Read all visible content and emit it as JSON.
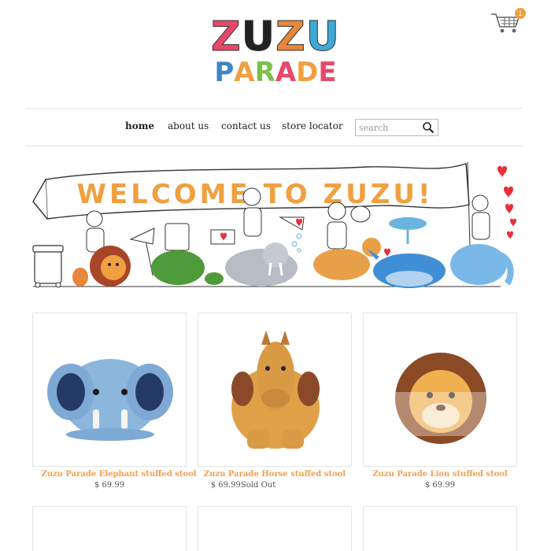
{
  "logo": {
    "top_letters": [
      "Z",
      "U",
      "Z",
      "U"
    ],
    "bottom_letters": [
      "P",
      "A",
      "R",
      "A",
      "D",
      "E"
    ],
    "top_colors": [
      "#e8486a",
      "#222222",
      "#e8863a",
      "#3fa9d6"
    ],
    "bottom_colors": [
      "#3f86c8",
      "#f0a040",
      "#7cbf4a",
      "#e8486a",
      "#f0a040",
      "#e8486a"
    ]
  },
  "cart": {
    "icon": "shopping-cart-icon",
    "count": "1"
  },
  "nav": {
    "items": [
      {
        "label": "home",
        "active": true
      },
      {
        "label": "about us",
        "active": false
      },
      {
        "label": "contact us",
        "active": false
      },
      {
        "label": "store locator",
        "active": false
      }
    ],
    "search_placeholder": "search"
  },
  "banner": {
    "text": "WELCOME TO ZUZU!",
    "accent": "#f0a040"
  },
  "products": [
    {
      "name": "Zuzu Parade Elephant stuffed stool",
      "price": "$ 69.99",
      "status": ""
    },
    {
      "name": "Zuzu Parade Horse stuffed stool",
      "price": "$ 69.99",
      "status": "Sold Out"
    },
    {
      "name": "Zuzu Parade Lion stuffed stool",
      "price": "$ 69.99",
      "status": ""
    }
  ],
  "colors": {
    "product_name": "#f2a04e",
    "badge": "#f0a040"
  }
}
